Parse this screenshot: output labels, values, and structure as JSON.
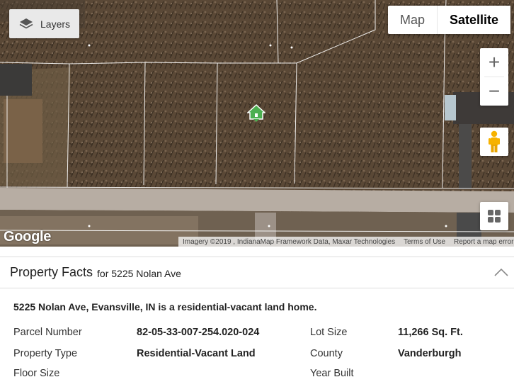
{
  "map": {
    "layers_label": "Layers",
    "map_type_options": [
      "Map",
      "Satellite"
    ],
    "active_map_type": "Satellite",
    "zoom_in_label": "+",
    "zoom_out_label": "−",
    "logo_text": "Google",
    "attribution": "Imagery ©2019 , IndianaMap Framework Data, Maxar Technologies",
    "terms_label": "Terms of Use",
    "report_label": "Report a map error",
    "marker_icon": "home-marker-icon",
    "colors": {
      "marker": "#4caf50",
      "parcel_lines": "#ffffff",
      "terrain": "#5b4a37"
    }
  },
  "facts": {
    "title": "Property Facts",
    "for_text": "for 5225 Nolan Ave",
    "summary": "5225 Nolan Ave, Evansville, IN is a residential-vacant land home.",
    "rows": [
      {
        "label": "Parcel Number",
        "value": "82-05-33-007-254.020-024"
      },
      {
        "label": "Property Type",
        "value": "Residential-Vacant Land"
      },
      {
        "label": "Floor Size",
        "value": ""
      },
      {
        "label": "Lot Size",
        "value": "11,266 Sq. Ft."
      },
      {
        "label": "County",
        "value": "Vanderburgh"
      },
      {
        "label": "Year Built",
        "value": ""
      }
    ]
  }
}
